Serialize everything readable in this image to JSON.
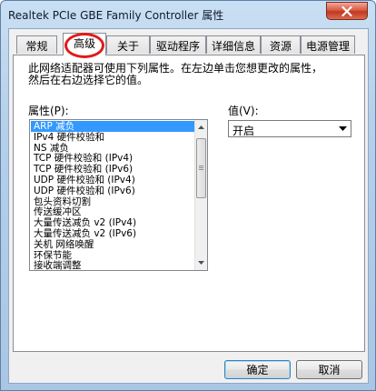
{
  "window": {
    "title": "Realtek PCIe GBE Family Controller 属性"
  },
  "tabs": [
    {
      "label": "常规"
    },
    {
      "label": "高级"
    },
    {
      "label": "关于"
    },
    {
      "label": "驱动程序"
    },
    {
      "label": "详细信息"
    },
    {
      "label": "资源"
    },
    {
      "label": "电源管理"
    }
  ],
  "advanced": {
    "description_line1": "此网络适配器可使用下列属性。在左边单击您想更改的属性，",
    "description_line2": "然后在右边选择它的值。",
    "property_label": "属性(P):",
    "value_label": "值(V):",
    "properties": [
      "ARP 减负",
      "IPv4 硬件校验和",
      "NS 减负",
      "TCP 硬件校验和 (IPv4)",
      "TCP 硬件校验和 (IPv6)",
      "UDP 硬件校验和 (IPv4)",
      "UDP 硬件校验和 (IPv6)",
      "包头资料切割",
      "传送缓冲区",
      "大量传送减负 v2 (IPv4)",
      "大量传送减负 v2 (IPv6)",
      "关机 网络唤醒",
      "环保节能",
      "接收端调整"
    ],
    "selected_value": "开启"
  },
  "buttons": {
    "ok": "确定",
    "cancel": "取消"
  }
}
